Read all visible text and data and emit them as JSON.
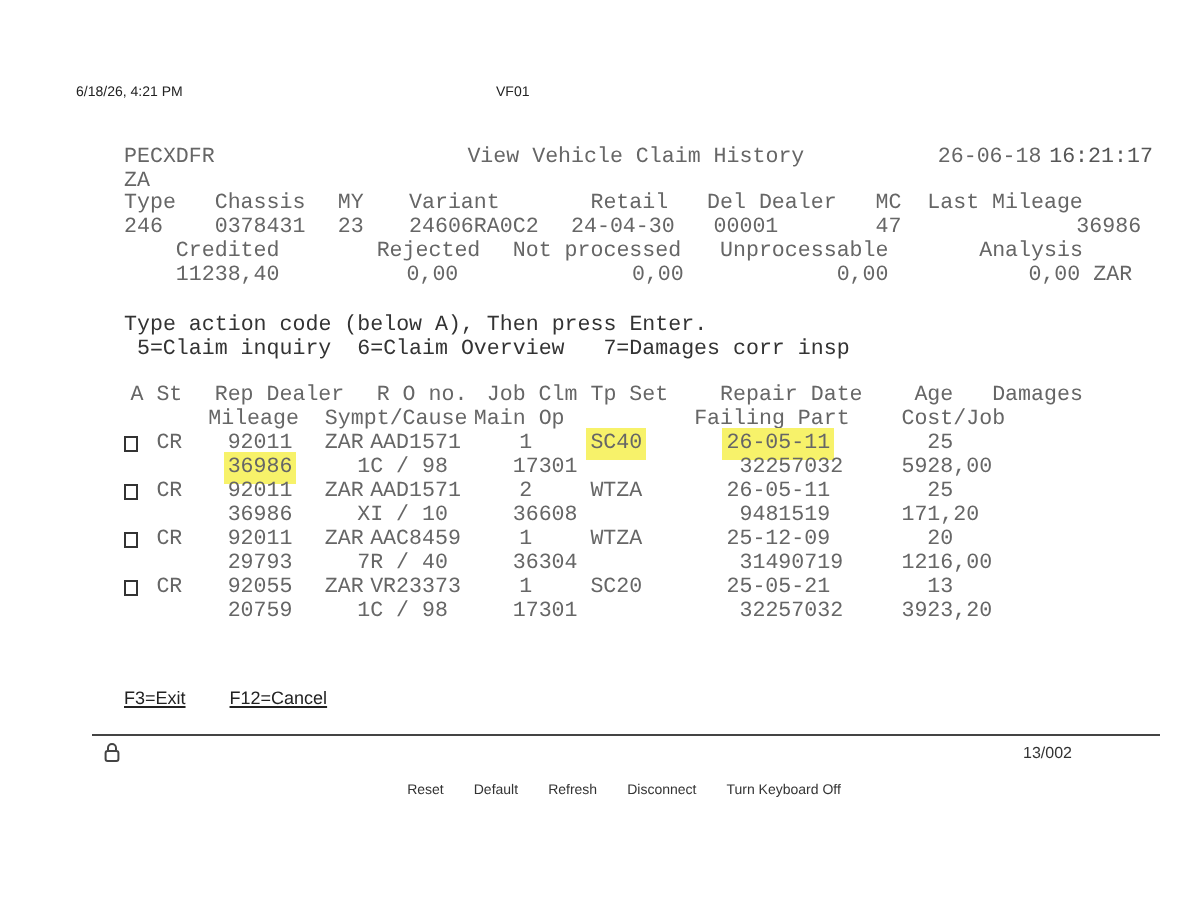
{
  "print_header": {
    "datetime": "6/18/26, 4:21 PM",
    "title": "VF01"
  },
  "screen": {
    "program": "PECXDFR",
    "title": "View Vehicle Claim History",
    "date": "26-06-18",
    "time": "16:21:17",
    "country": "ZA",
    "vehicle_labels": [
      "Type",
      "Chassis",
      "MY",
      "Variant",
      "Retail",
      "Del Dealer",
      "MC",
      "Last Mileage"
    ],
    "vehicle_values": [
      "246",
      "0378431",
      "23",
      "24606RA0C2",
      "24-04-30",
      "00001",
      "47",
      "36986"
    ],
    "totals_labels": [
      "Credited",
      "Rejected",
      "Not processed",
      "Unprocessable",
      "Analysis"
    ],
    "totals_values": [
      "11238,40",
      "0,00",
      "0,00",
      "0,00",
      "0,00 ZAR"
    ],
    "instruction": "Type action code (below A), Then press Enter.",
    "options": [
      "5=Claim inquiry",
      "6=Claim Overview",
      "7=Damages corr insp"
    ],
    "headers_1": [
      "A",
      "St",
      "Rep Dealer",
      "R O no.",
      "Job",
      "Clm Tp Set",
      "Repair Date",
      "Age",
      "Damages"
    ],
    "headers_2": [
      "Mileage",
      "Sympt/Cause",
      "Main Op",
      "Failing Part",
      "Cost/Job"
    ],
    "rows": [
      {
        "checked": false,
        "line_1": [
          {
            "text": "CR",
            "highlighted": false
          },
          {
            "text": "92011",
            "highlighted": false
          },
          {
            "text": "ZAR",
            "highlighted": false
          },
          {
            "text": "AAD1571",
            "highlighted": false
          },
          {
            "text": "1",
            "highlighted": false
          },
          {
            "text": "SC40",
            "highlighted": true
          },
          {
            "text": "26-05-11",
            "highlighted": true
          },
          {
            "text": "25",
            "highlighted": false
          }
        ],
        "line_2": [
          {
            "text": "36986",
            "highlighted": true
          },
          {
            "text": "1C / 98",
            "highlighted": false
          },
          {
            "text": "17301",
            "highlighted": false
          },
          {
            "text": "32257032",
            "highlighted": false
          },
          {
            "text": "5928,00",
            "highlighted": false
          }
        ]
      },
      {
        "checked": false,
        "line_1": [
          {
            "text": "CR",
            "highlighted": false
          },
          {
            "text": "92011",
            "highlighted": false
          },
          {
            "text": "ZAR",
            "highlighted": false
          },
          {
            "text": "AAD1571",
            "highlighted": false
          },
          {
            "text": "2",
            "highlighted": false
          },
          {
            "text": "WTZA",
            "highlighted": false
          },
          {
            "text": "26-05-11",
            "highlighted": false
          },
          {
            "text": "25",
            "highlighted": false
          }
        ],
        "line_2": [
          {
            "text": "36986",
            "highlighted": false
          },
          {
            "text": "XI / 10",
            "highlighted": false
          },
          {
            "text": "36608",
            "highlighted": false
          },
          {
            "text": "9481519",
            "highlighted": false
          },
          {
            "text": "171,20",
            "highlighted": false
          }
        ]
      },
      {
        "checked": false,
        "line_1": [
          {
            "text": "CR",
            "highlighted": false
          },
          {
            "text": "92011",
            "highlighted": false
          },
          {
            "text": "ZAR",
            "highlighted": false
          },
          {
            "text": "AAC8459",
            "highlighted": false
          },
          {
            "text": "1",
            "highlighted": false
          },
          {
            "text": "WTZA",
            "highlighted": false
          },
          {
            "text": "25-12-09",
            "highlighted": false
          },
          {
            "text": "20",
            "highlighted": false
          }
        ],
        "line_2": [
          {
            "text": "29793",
            "highlighted": false
          },
          {
            "text": "7R / 40",
            "highlighted": false
          },
          {
            "text": "36304",
            "highlighted": false
          },
          {
            "text": "31490719",
            "highlighted": false
          },
          {
            "text": "1216,00",
            "highlighted": false
          }
        ]
      },
      {
        "checked": false,
        "line_1": [
          {
            "text": "CR",
            "highlighted": false
          },
          {
            "text": "92055",
            "highlighted": false
          },
          {
            "text": "ZAR",
            "highlighted": false
          },
          {
            "text": "VR23373",
            "highlighted": false
          },
          {
            "text": "1",
            "highlighted": false
          },
          {
            "text": "SC20",
            "highlighted": false
          },
          {
            "text": "25-05-21",
            "highlighted": false
          },
          {
            "text": "13",
            "highlighted": false
          }
        ],
        "line_2": [
          {
            "text": "20759",
            "highlighted": false
          },
          {
            "text": "1C / 98",
            "highlighted": false
          },
          {
            "text": "17301",
            "highlighted": false
          },
          {
            "text": "32257032",
            "highlighted": false
          },
          {
            "text": "3923,20",
            "highlighted": false
          }
        ]
      }
    ],
    "function_keys": [
      "F3=Exit",
      "F12=Cancel"
    ]
  },
  "status_bar": {
    "position": "13/002"
  },
  "buttons": [
    "Reset",
    "Default",
    "Refresh",
    "Disconnect",
    "Turn Keyboard Off"
  ]
}
